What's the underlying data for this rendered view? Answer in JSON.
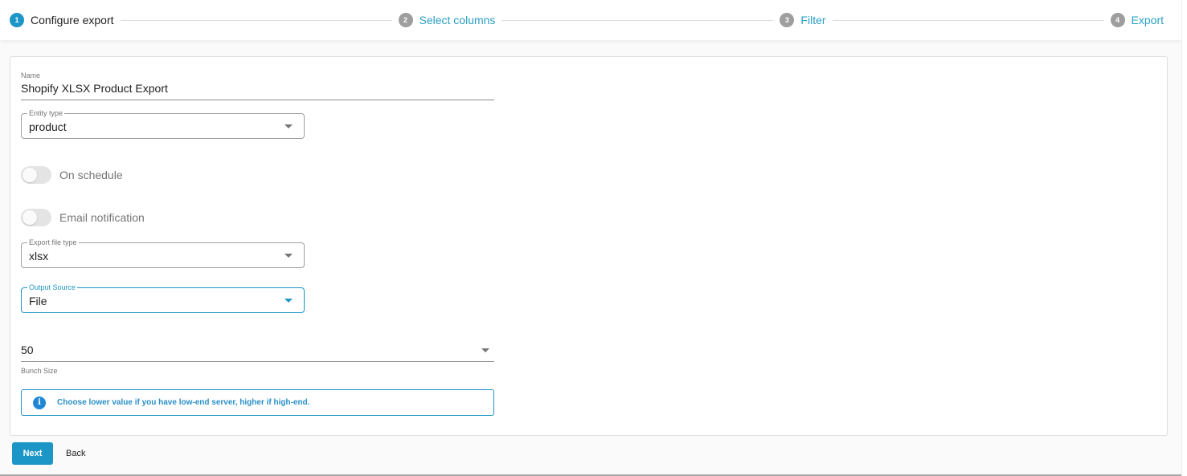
{
  "stepper": {
    "steps": [
      {
        "number": "1",
        "label": "Configure export",
        "active": true
      },
      {
        "number": "2",
        "label": "Select columns",
        "active": false
      },
      {
        "number": "3",
        "label": "Filter",
        "active": false
      },
      {
        "number": "4",
        "label": "Export",
        "active": false
      }
    ]
  },
  "form": {
    "name": {
      "label": "Name",
      "value": "Shopify XLSX Product Export"
    },
    "entity_type": {
      "label": "Entity type",
      "value": "product"
    },
    "on_schedule": {
      "label": "On schedule",
      "checked": false
    },
    "email_notification": {
      "label": "Email notification",
      "checked": false
    },
    "export_file_type": {
      "label": "Export file type",
      "value": "xlsx"
    },
    "output_source": {
      "label": "Output Source",
      "value": "File"
    },
    "bunch_size": {
      "label": "Bunch Size",
      "value": "50"
    },
    "info": {
      "icon": "info-icon",
      "glyph": "i",
      "text": "Choose lower value if you have low-end server, higher if high-end."
    }
  },
  "actions": {
    "next_label": "Next",
    "back_label": "Back"
  },
  "colors": {
    "accent": "#1b96c7",
    "inactive_step": "#9e9e9e"
  }
}
